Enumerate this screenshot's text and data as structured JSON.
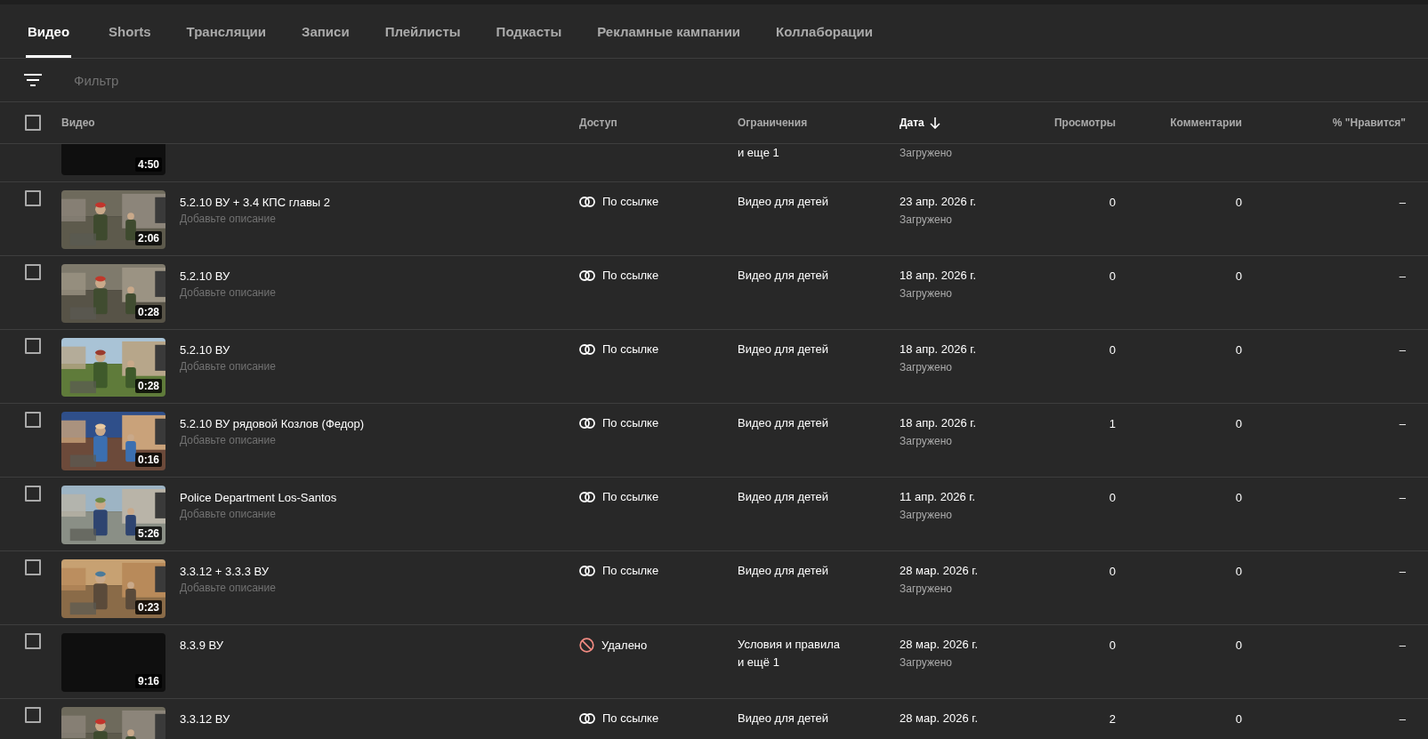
{
  "tabs": [
    {
      "label": "Видео",
      "selected": true
    },
    {
      "label": "Shorts",
      "selected": false
    },
    {
      "label": "Трансляции",
      "selected": false
    },
    {
      "label": "Записи",
      "selected": false
    },
    {
      "label": "Плейлисты",
      "selected": false
    },
    {
      "label": "Подкасты",
      "selected": false
    },
    {
      "label": "Рекламные кампании",
      "selected": false
    },
    {
      "label": "Коллаборации",
      "selected": false
    }
  ],
  "filter": {
    "placeholder": "Фильтр"
  },
  "table": {
    "select_all": {
      "checked": false
    },
    "columns": [
      {
        "label": "Видео",
        "sorted": false
      },
      {
        "label": "Доступ",
        "sorted": false
      },
      {
        "label": "Ограничения",
        "sorted": false
      },
      {
        "label": "Дата",
        "sorted": true
      },
      {
        "label": "Просмотры",
        "sorted": false
      },
      {
        "label": "Комментарии",
        "sorted": false
      },
      {
        "label": "% \"Нравится\"",
        "sorted": false
      }
    ],
    "rows": [
      {
        "kind": "partial",
        "thumbnail": {
          "kind": "blank"
        },
        "duration": "4:50",
        "restrictions": [
          "и еще 1"
        ],
        "status": "Загружено"
      },
      {
        "kind": "full",
        "checked": false,
        "thumbnail": {
          "kind": "picture"
        },
        "duration": "2:06",
        "title": "5.2.10 ВУ + 3.4 КПС главы 2",
        "description": "Добавьте описание",
        "access": {
          "kind": "link",
          "label": "По ссылке"
        },
        "restrictions": [
          "Видео для детей"
        ],
        "date": "23 апр. 2026 г.",
        "status": "Загружено",
        "views": "0",
        "comments": "0",
        "likes": "–"
      },
      {
        "kind": "full",
        "checked": false,
        "thumbnail": {
          "kind": "picture"
        },
        "duration": "0:28",
        "title": "5.2.10 ВУ",
        "description": "Добавьте описание",
        "access": {
          "kind": "link",
          "label": "По ссылке"
        },
        "restrictions": [
          "Видео для детей"
        ],
        "date": "18 апр. 2026 г.",
        "status": "Загружено",
        "views": "0",
        "comments": "0",
        "likes": "–"
      },
      {
        "kind": "full",
        "checked": false,
        "thumbnail": {
          "kind": "picture"
        },
        "duration": "0:28",
        "title": "5.2.10 ВУ",
        "description": "Добавьте описание",
        "access": {
          "kind": "link",
          "label": "По ссылке"
        },
        "restrictions": [
          "Видео для детей"
        ],
        "date": "18 апр. 2026 г.",
        "status": "Загружено",
        "views": "0",
        "comments": "0",
        "likes": "–"
      },
      {
        "kind": "full",
        "checked": false,
        "thumbnail": {
          "kind": "picture"
        },
        "duration": "0:16",
        "title": "5.2.10 ВУ рядовой Козлов (Федор)",
        "description": "Добавьте описание",
        "access": {
          "kind": "link",
          "label": "По ссылке"
        },
        "restrictions": [
          "Видео для детей"
        ],
        "date": "18 апр. 2026 г.",
        "status": "Загружено",
        "views": "1",
        "comments": "0",
        "likes": "–"
      },
      {
        "kind": "full",
        "checked": false,
        "thumbnail": {
          "kind": "picture"
        },
        "duration": "5:26",
        "title": "Police Department Los-Santos",
        "description": "Добавьте описание",
        "access": {
          "kind": "link",
          "label": "По ссылке"
        },
        "restrictions": [
          "Видео для детей"
        ],
        "date": "11 апр. 2026 г.",
        "status": "Загружено",
        "views": "0",
        "comments": "0",
        "likes": "–"
      },
      {
        "kind": "full",
        "checked": false,
        "thumbnail": {
          "kind": "picture"
        },
        "duration": "0:23",
        "title": "3.3.12 + 3.3.3 ВУ",
        "description": "Добавьте описание",
        "access": {
          "kind": "link",
          "label": "По ссылке"
        },
        "restrictions": [
          "Видео для детей"
        ],
        "date": "28 мар. 2026 г.",
        "status": "Загружено",
        "views": "0",
        "comments": "0",
        "likes": "–"
      },
      {
        "kind": "full",
        "checked": false,
        "thumbnail": {
          "kind": "blank"
        },
        "duration": "9:16",
        "title": "8.3.9 ВУ",
        "access": {
          "kind": "deleted",
          "label": "Удалено"
        },
        "restrictions": [
          "Условия и правила",
          "и ещё 1"
        ],
        "date": "28 мар. 2026 г.",
        "status": "Загружено",
        "views": "0",
        "comments": "0",
        "likes": "–"
      },
      {
        "kind": "full",
        "checked": false,
        "thumbnail": {
          "kind": "picture"
        },
        "title": "3.3.12 ВУ",
        "access": {
          "kind": "link",
          "label": "По ссылке"
        },
        "restrictions": [
          "Видео для детей"
        ],
        "date": "28 мар. 2026 г.",
        "views": "2",
        "comments": "0",
        "likes": "–"
      }
    ]
  }
}
